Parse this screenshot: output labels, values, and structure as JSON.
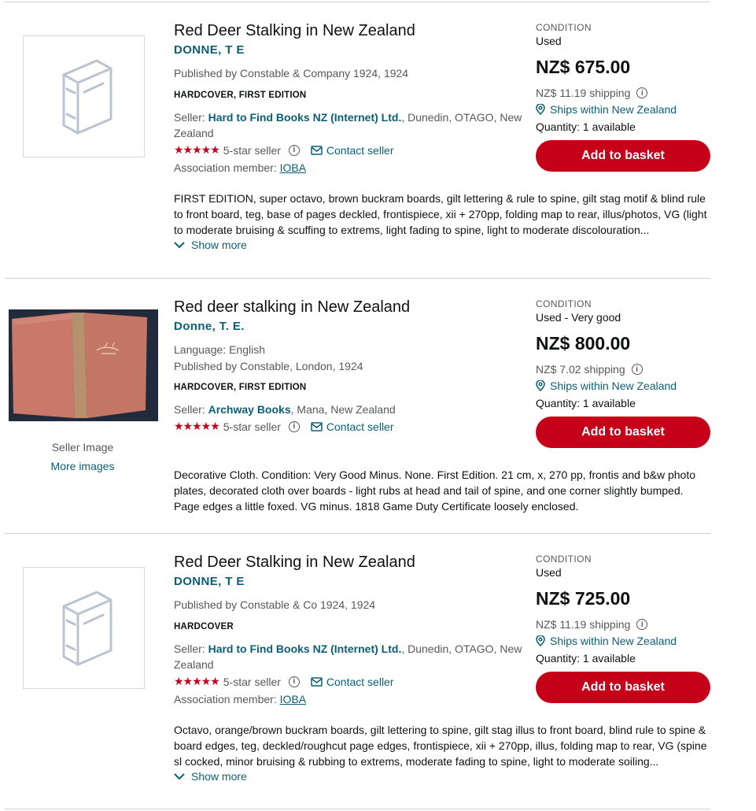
{
  "listings": [
    {
      "title": "Red Deer Stalking in New Zealand",
      "author": "DONNE, T E",
      "published": "Published by Constable & Company 1924, 1924",
      "binding": "HARDCOVER, FIRST EDITION",
      "seller_prefix": "Seller: ",
      "seller_name": "Hard to Find Books NZ (Internet) Ltd.",
      "seller_location": ", Dunedin, OTAGO, New Zealand",
      "rating_label": "5-star seller",
      "contact_label": "Contact seller",
      "association_prefix": "Association member: ",
      "association": "IOBA",
      "description": "FIRST EDITION, super octavo, brown buckram boards, gilt lettering & rule to spine, gilt stag motif & blind rule to front board, teg, base of pages deckled, frontispiece, xii + 270pp, folding map to rear, illus/photos, VG (light to moderate bruising & scuffing to extrems, light fading to spine, light to moderate discolouration...",
      "show_more": "Show more",
      "condition_label": "CONDITION",
      "condition": "Used",
      "price": "NZ$ 675.00",
      "shipping": "NZ$ 11.19 shipping",
      "ships_within": "Ships within New Zealand",
      "quantity": "Quantity: 1 available",
      "add_to_basket": "Add to basket"
    },
    {
      "title": "Red deer stalking in New Zealand",
      "author": "Donne, T. E.",
      "language": "Language: English",
      "published": "Published by Constable, London, 1924",
      "binding": "HARDCOVER, FIRST EDITION",
      "seller_prefix": "Seller: ",
      "seller_name": "Archway Books",
      "seller_location": ", Mana, New Zealand",
      "rating_label": "5-star seller",
      "contact_label": "Contact seller",
      "seller_image_label": "Seller Image",
      "more_images": "More images",
      "description": "Decorative Cloth. Condition: Very Good Minus. None. First Edition. 21 cm, x, 270 pp, frontis and b&w photo plates, decorated cloth over boards - light rubs at head and tail of spine, and one corner slightly bumped. Page edges a little foxed. VG minus. 1818 Game Duty Certificate loosely enclosed.",
      "condition_label": "CONDITION",
      "condition": "Used - Very good",
      "price": "NZ$ 800.00",
      "shipping": "NZ$ 7.02 shipping",
      "ships_within": "Ships within New Zealand",
      "quantity": "Quantity: 1 available",
      "add_to_basket": "Add to basket"
    },
    {
      "title": "Red Deer Stalking in New Zealand",
      "author": "DONNE, T E",
      "published": "Published by Constable & Co 1924, 1924",
      "binding": "HARDCOVER",
      "seller_prefix": "Seller: ",
      "seller_name": "Hard to Find Books NZ (Internet) Ltd.",
      "seller_location": ", Dunedin, OTAGO, New Zealand",
      "rating_label": "5-star seller",
      "contact_label": "Contact seller",
      "association_prefix": "Association member: ",
      "association": "IOBA",
      "description": "Octavo, orange/brown buckram boards, gilt lettering to spine, gilt stag illus to front board, blind rule to spine & board edges, teg, deckled/roughcut page edges, frontispiece, xii + 270pp, illus, folding map to rear, VG (spine sl cocked, minor bruising & rubbing to extrems, moderate fading to spine, light to moderate soiling...",
      "show_more": "Show more",
      "condition_label": "CONDITION",
      "condition": "Used",
      "price": "NZ$ 725.00",
      "shipping": "NZ$ 11.19 shipping",
      "ships_within": "Ships within New Zealand",
      "quantity": "Quantity: 1 available",
      "add_to_basket": "Add to basket"
    }
  ],
  "icons": {
    "star": "★",
    "info": "i",
    "placeholder": "book-placeholder-icon",
    "envelope": "envelope-icon",
    "location": "location-pin-icon",
    "chevron": "chevron-down-icon"
  },
  "colors": {
    "accent_link": "#0b5f74",
    "basket_button": "#c7001a",
    "stars": "#c7001a"
  }
}
